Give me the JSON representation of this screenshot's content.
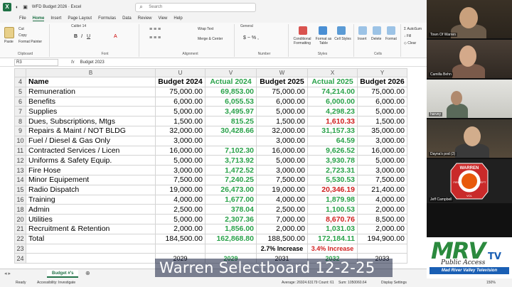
{
  "titlebar": {
    "title": "WFD Budget 2026  ·  Excel",
    "search_placeholder": "Search"
  },
  "menu": [
    "File",
    "Home",
    "Insert",
    "Page Layout",
    "Formulas",
    "Data",
    "Review",
    "View",
    "Help"
  ],
  "ribbon": {
    "paste": "Paste",
    "cut": "Cut",
    "copy": "Copy",
    "format_painter": "Format Painter",
    "clipboard": "Clipboard",
    "font_name": "Calibri",
    "font_size": "14",
    "font": "Font",
    "wrap_text": "Wrap Text",
    "merge_center": "Merge & Center",
    "alignment": "Alignment",
    "number_format": "General",
    "number": "Number",
    "conditional": "Conditional Formatting",
    "format_table": "Format as Table",
    "cell_styles": "Cell Styles",
    "styles": "Styles",
    "insert": "Insert",
    "delete": "Delete",
    "format": "Format",
    "cells": "Cells",
    "autosum": "AutoSum",
    "fill": "Fill",
    "clear": "Clear"
  },
  "formula": {
    "namebox": "R3",
    "fx": "fx",
    "content": "Budget 2023"
  },
  "columns": [
    "B",
    "U",
    "V",
    "W",
    "X",
    "Y"
  ],
  "rows": [
    {
      "n": "4",
      "name": "Name",
      "u": "Budget 2024",
      "v": "Actual 2024",
      "w": "Budget 2025",
      "x": "Actual 2025",
      "y": "Budget 2026",
      "header": true
    },
    {
      "n": "5",
      "name": "Remuneration",
      "u": "75,000.00",
      "v": "69,853.00",
      "w": "75,000.00",
      "x": "74,214.00",
      "y": "75,000.00",
      "xc": "green"
    },
    {
      "n": "6",
      "name": "Benefits",
      "u": "6,000.00",
      "v": "6,055.53",
      "w": "6,000.00",
      "x": "6,000.00",
      "y": "6,000.00",
      "xc": "green"
    },
    {
      "n": "7",
      "name": "Supplies",
      "u": "5,000.00",
      "v": "3,495.97",
      "w": "5,000.00",
      "x": "4,298.23",
      "y": "5,000.00",
      "xc": "green"
    },
    {
      "n": "8",
      "name": "Dues, Subscriptions, Mtgs",
      "u": "1,500.00",
      "v": "815.25",
      "w": "1,500.00",
      "x": "1,610.33",
      "y": "1,500.00",
      "xc": "red"
    },
    {
      "n": "9",
      "name": "Repairs & Maint / NOT BLDG",
      "u": "32,000.00",
      "v": "30,428.66",
      "w": "32,000.00",
      "x": "31,157.33",
      "y": "35,000.00",
      "xc": "green"
    },
    {
      "n": "10",
      "name": "Fuel / Diesel & Gas Only",
      "u": "3,000.00",
      "v": "",
      "w": "3,000.00",
      "x": "64.59",
      "y": "3,000.00",
      "xc": "green"
    },
    {
      "n": "11",
      "name": "Contracted Services / Licen",
      "u": "16,000.00",
      "v": "7,102.30",
      "w": "16,000.00",
      "x": "9,626.52",
      "y": "16,000.00",
      "xc": "green"
    },
    {
      "n": "12",
      "name": "Uniforms & Safety Equip.",
      "u": "5,000.00",
      "v": "3,713.92",
      "w": "5,000.00",
      "x": "3,930.78",
      "y": "5,000.00",
      "xc": "green"
    },
    {
      "n": "13",
      "name": "Fire Hose",
      "u": "3,000.00",
      "v": "1,472.52",
      "w": "3,000.00",
      "x": "2,723.31",
      "y": "3,000.00",
      "xc": "green"
    },
    {
      "n": "14",
      "name": "Minor Equipement",
      "u": "7,500.00",
      "v": "7,240.25",
      "w": "7,500.00",
      "x": "5,530.53",
      "y": "7,500.00",
      "xc": "green"
    },
    {
      "n": "15",
      "name": "Radio Dispatch",
      "u": "19,000.00",
      "v": "26,473.00",
      "w": "19,000.00",
      "x": "20,346.19",
      "y": "21,400.00",
      "xc": "red"
    },
    {
      "n": "16",
      "name": "Training",
      "u": "4,000.00",
      "v": "1,677.00",
      "w": "4,000.00",
      "x": "1,879.98",
      "y": "4,000.00",
      "xc": "green"
    },
    {
      "n": "18",
      "name": "Admin",
      "u": "2,500.00",
      "v": "378.04",
      "w": "2,500.00",
      "x": "1,100.53",
      "y": "2,000.00",
      "xc": "green"
    },
    {
      "n": "20",
      "name": "Utilities",
      "u": "5,000.00",
      "v": "2,307.36",
      "w": "7,000.00",
      "x": "8,670.76",
      "y": "8,500.00",
      "xc": "red"
    },
    {
      "n": "21",
      "name": "Recruitment & Retention",
      "u": "2,000.00",
      "v": "1,856.00",
      "w": "2,000.00",
      "x": "1,031.03",
      "y": "2,000.00",
      "xc": "green"
    },
    {
      "n": "22",
      "name": "Total",
      "u": "184,500.00",
      "v": "162,868.80",
      "w": "188,500.00",
      "x": "172,184.11",
      "y": "194,900.00",
      "xc": "green"
    },
    {
      "n": "23",
      "name": "",
      "u": "",
      "v": "",
      "w": "2.7% Increase",
      "x": "3.4% Increase",
      "y": "",
      "increase": true
    },
    {
      "n": "24",
      "name": "",
      "u": "2029",
      "v": "2029",
      "w": "2031",
      "x": "2032",
      "y": "2033"
    }
  ],
  "sheet_tab": "Budget #'s",
  "status": {
    "ready": "Ready",
    "accessibility": "Accessibility: Investigate",
    "average": "Average: 26924.63179",
    "count": "Count: 61",
    "sum": "Sum: 1050060.64",
    "display": "Display Settings",
    "zoom": "150%"
  },
  "caption": "Warren Selectboard 12-2-25",
  "participants": [
    {
      "name": "Town Of Warren"
    },
    {
      "name": "Camilla Behn"
    },
    {
      "name": "harvey"
    },
    {
      "name": "Dayna's pod (2)"
    },
    {
      "name": "Jeff Campbell"
    }
  ],
  "logo": {
    "mrv": "MRV",
    "tv": "TV",
    "public_access": "Public Access",
    "network": "Mad River Valley Television",
    "badge_top": "WARREN",
    "badge_side_left": "FIRE",
    "badge_side_right": "DEPT",
    "badge_bottom": "VOL"
  },
  "colors": {
    "excel_green": "#1e7145",
    "value_green": "#2aa24a",
    "value_red": "#d02020",
    "logo_green": "#2b8a3e",
    "logo_blue": "#1a5fb4"
  }
}
